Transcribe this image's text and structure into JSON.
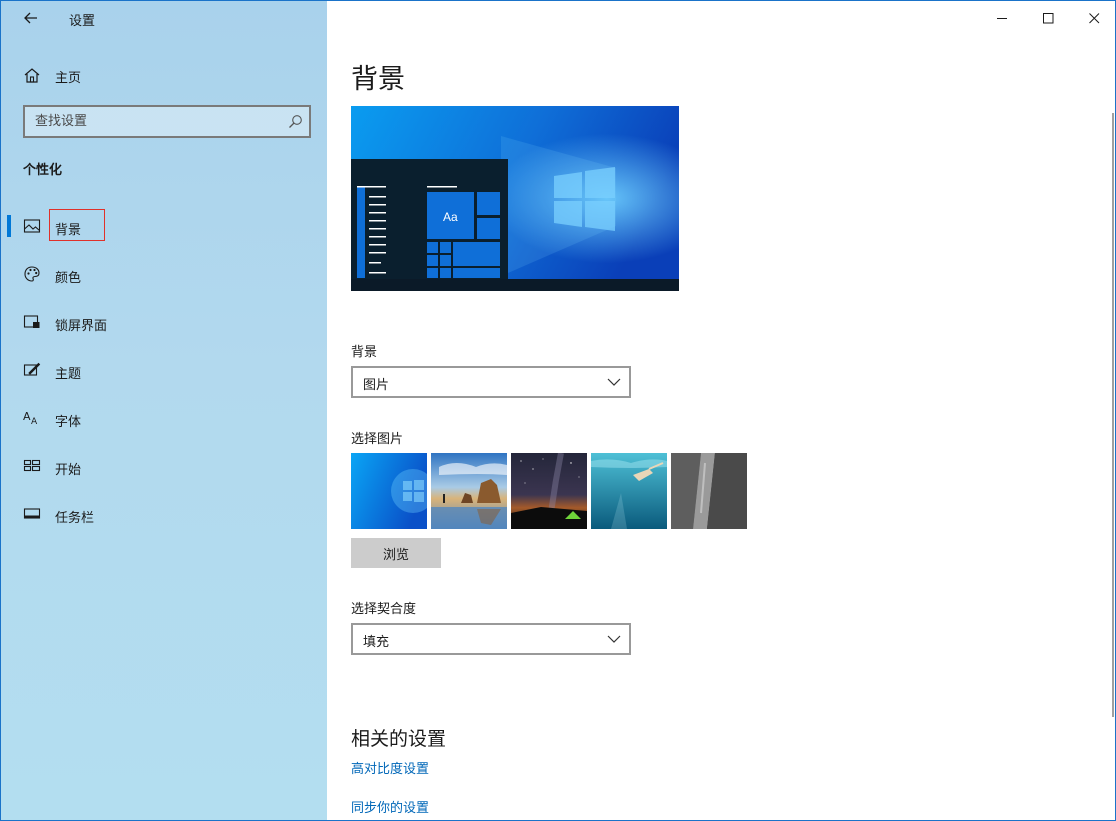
{
  "window": {
    "app_title": "设置",
    "controls": [
      "minimize-icon",
      "maximize-icon",
      "close-icon"
    ]
  },
  "sidebar": {
    "home_label": "主页",
    "search_placeholder": "查找设置",
    "section_title": "个性化",
    "items": [
      {
        "label": "背景",
        "icon": "picture-icon",
        "active": true
      },
      {
        "label": "颜色",
        "icon": "palette-icon",
        "active": false
      },
      {
        "label": "锁屏界面",
        "icon": "lock-screen-icon",
        "active": false
      },
      {
        "label": "主题",
        "icon": "theme-icon",
        "active": false
      },
      {
        "label": "字体",
        "icon": "font-icon",
        "active": false
      },
      {
        "label": "开始",
        "icon": "start-icon",
        "active": false
      },
      {
        "label": "任务栏",
        "icon": "taskbar-icon",
        "active": false
      }
    ]
  },
  "main": {
    "title": "背景",
    "preview": {
      "tile_text": "Aa"
    },
    "background_label": "背景",
    "background_value": "图片",
    "choose_picture_label": "选择图片",
    "thumbnails": [
      "windows-blue",
      "beach-rocks",
      "night-sky-tent",
      "underwater-swimmer",
      "rock-cliff"
    ],
    "browse_label": "浏览",
    "fit_label": "选择契合度",
    "fit_value": "填充",
    "related_title": "相关的设置",
    "links": [
      "高对比度设置",
      "同步你的设置"
    ]
  },
  "colors": {
    "accent": "#0078d7",
    "link": "#0067b8",
    "sidebar_bg": "#b2d9ee",
    "highlight_border": "#e0312a"
  }
}
